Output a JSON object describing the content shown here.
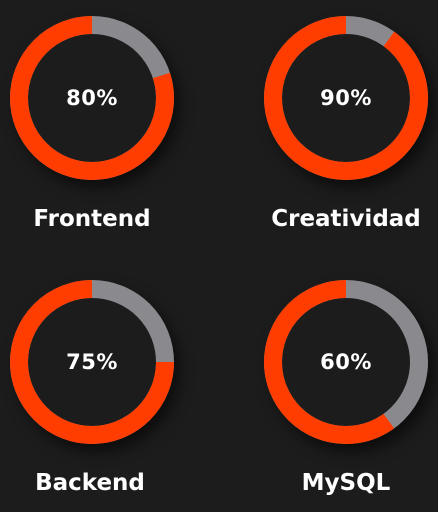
{
  "colors": {
    "background": "#1c1c1c",
    "progress": "#ff3d00",
    "track": "#8a8a8e",
    "text": "#ffffff"
  },
  "skills": [
    {
      "label": "Frontend",
      "percent_text": "80%",
      "percent": 80
    },
    {
      "label": "Creatividad",
      "percent_text": "90%",
      "percent": 90
    },
    {
      "label": "Backend",
      "percent_text": "75%",
      "percent": 75
    },
    {
      "label": "MySQL",
      "percent_text": "60%",
      "percent": 60
    }
  ]
}
